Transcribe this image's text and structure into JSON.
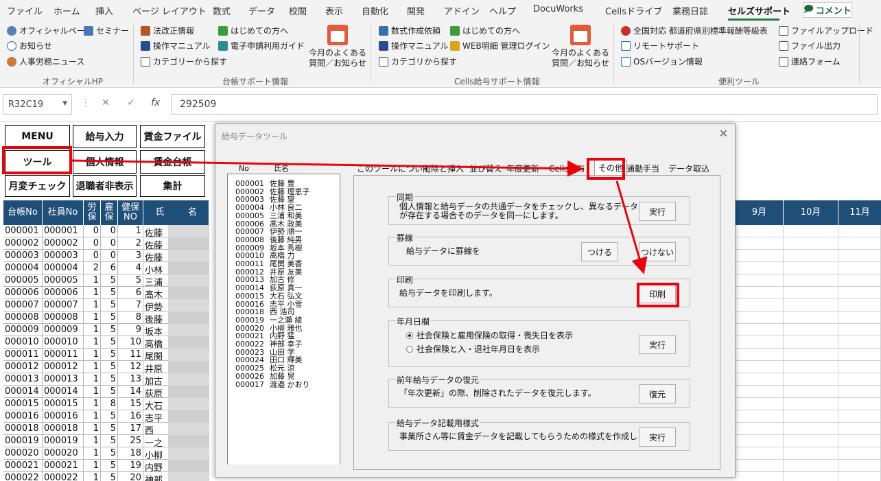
{
  "ribbon_tabs": [
    "ファイル",
    "ホーム",
    "挿入",
    "ページ レイアウト",
    "数式",
    "データ",
    "校閲",
    "表示",
    "自動化",
    "開発",
    "アドイン",
    "ヘルプ",
    "DocuWorks",
    "Cellsドライブ",
    "業務日誌",
    "セルズサポート"
  ],
  "comment_label": "コメント",
  "ribbon": {
    "g1": {
      "items": [
        "オフィシャルページ",
        "お知らせ",
        "人事労務ニュース",
        "セミナー"
      ],
      "label": "オフィシャルHP"
    },
    "g2": {
      "items": [
        "法改正情報",
        "操作マニュアル",
        "カテゴリーから探す",
        "はじめての方へ",
        "電子申請利用ガイド"
      ],
      "big": "今月のよくある\n質問／お知らせ",
      "label": "台帳サポート情報"
    },
    "g3": {
      "items": [
        "数式作成依頼",
        "操作マニュアル",
        "カテゴリから探す",
        "はじめての方へ",
        "WEB明細 管理ログイン"
      ],
      "big": "今月のよくある\n質問／お知らせ",
      "label": "Cells給与サポート情報"
    },
    "g4": {
      "items": [
        "全国対応 都道府県別標準報酬等級表",
        "リモートサポート",
        "OSバージョン情報",
        "ファイルアップロード",
        "ファイル出力",
        "連絡フォーム"
      ],
      "label": "便利ツール"
    }
  },
  "formula_bar": {
    "name_box": "R32C19",
    "cancel": "✕",
    "enter": "✓",
    "fx": "fx",
    "value": "292509"
  },
  "sheet_buttons": [
    "MENU",
    "給与入力",
    "賃金ファイル",
    "ツール",
    "個人情報",
    "賃金台帳",
    "月変チェック",
    "退職者非表示",
    "集計"
  ],
  "grid_headers": [
    "台帳No",
    "社員No",
    "労\n保",
    "雇\n保",
    "健保\nNO",
    "氏",
    "名"
  ],
  "month_headers": [
    "9月",
    "10月",
    "11月"
  ],
  "grid_rows": [
    [
      "000001",
      "000001",
      "0",
      "0",
      "1",
      "佐藤"
    ],
    [
      "000002",
      "000002",
      "0",
      "0",
      "2",
      "佐藤"
    ],
    [
      "000003",
      "000003",
      "0",
      "0",
      "3",
      "佐藤"
    ],
    [
      "000004",
      "000004",
      "2",
      "6",
      "4",
      "小林"
    ],
    [
      "000005",
      "000005",
      "1",
      "5",
      "5",
      "三浦"
    ],
    [
      "000006",
      "000006",
      "1",
      "5",
      "6",
      "髙木"
    ],
    [
      "000007",
      "000007",
      "1",
      "5",
      "7",
      "伊勢"
    ],
    [
      "000008",
      "000008",
      "1",
      "5",
      "8",
      "後藤"
    ],
    [
      "000009",
      "000009",
      "1",
      "5",
      "9",
      "坂本"
    ],
    [
      "000010",
      "000010",
      "1",
      "5",
      "10",
      "高橋"
    ],
    [
      "000011",
      "000011",
      "1",
      "5",
      "11",
      "尾関"
    ],
    [
      "000012",
      "000012",
      "1",
      "5",
      "12",
      "井原"
    ],
    [
      "000013",
      "000013",
      "1",
      "5",
      "13",
      "加古"
    ],
    [
      "000014",
      "000014",
      "1",
      "5",
      "14",
      "荻原"
    ],
    [
      "000015",
      "000015",
      "1",
      "8",
      "15",
      "大石"
    ],
    [
      "000016",
      "000016",
      "1",
      "5",
      "16",
      "志平"
    ],
    [
      "000018",
      "000018",
      "1",
      "5",
      "17",
      "西"
    ],
    [
      "000019",
      "000019",
      "1",
      "5",
      "25",
      "一之"
    ],
    [
      "000020",
      "000020",
      "1",
      "5",
      "18",
      "小柳"
    ],
    [
      "000021",
      "000021",
      "1",
      "5",
      "19",
      "内野"
    ],
    [
      "000022",
      "000022",
      "1",
      "5",
      "20",
      "神部"
    ]
  ],
  "dialog": {
    "title": "給与データツール",
    "list_header_no": "No",
    "list_header_name": "氏名",
    "list": [
      [
        "000001",
        "佐藤 豊"
      ],
      [
        "000002",
        "佐藤 理恵子"
      ],
      [
        "000003",
        "佐藤 望"
      ],
      [
        "000004",
        "小林 良二"
      ],
      [
        "000005",
        "三浦 和美"
      ],
      [
        "000006",
        "髙木 政美"
      ],
      [
        "000007",
        "伊勢 順一"
      ],
      [
        "000008",
        "後藤 純男"
      ],
      [
        "000009",
        "坂本 秀樹"
      ],
      [
        "000010",
        "高橋 力"
      ],
      [
        "000011",
        "尾関 美香"
      ],
      [
        "000012",
        "井原 友美"
      ],
      [
        "000013",
        "加古 修"
      ],
      [
        "000014",
        "荻原 真一"
      ],
      [
        "000015",
        "大石 弘文"
      ],
      [
        "000016",
        "志平 小雪"
      ],
      [
        "000018",
        "西 浩司"
      ],
      [
        "000019",
        "一之瀬 綾"
      ],
      [
        "000020",
        "小柳 雅也"
      ],
      [
        "000021",
        "内野 猛"
      ],
      [
        "000022",
        "神部 幸子"
      ],
      [
        "000023",
        "山田 学"
      ],
      [
        "000024",
        "田口 輝美"
      ],
      [
        "000025",
        "松元 涼"
      ],
      [
        "000026",
        "加藤 晃"
      ],
      [
        "000017",
        "渡邉 かおり"
      ]
    ],
    "tabs": [
      "このツールについて",
      "削除と挿入",
      "並び替え",
      "年度更新",
      "Cells給与",
      "その他",
      "通勤手当",
      "データ取込"
    ],
    "groups": [
      {
        "title": "同期",
        "desc": "個人情報と給与データの共通データをチェックし、異なるデータ\nが存在する場合そのデータを同一にします。",
        "buttons": [
          "実行"
        ]
      },
      {
        "title": "罫線",
        "desc": "給与データに罫線を",
        "buttons": [
          "つける",
          "つけない"
        ]
      },
      {
        "title": "印刷",
        "desc": "給与データを印刷します。",
        "buttons": [
          "印刷"
        ]
      },
      {
        "title": "年月日欄",
        "options": [
          "社会保険と雇用保険の取得・喪失日を表示",
          "社会保険と入・退社年月日を表示"
        ],
        "buttons": [
          "実行"
        ]
      },
      {
        "title": "前年給与データの復元",
        "desc": "「年次更新」の際、削除されたデータを復元します。",
        "buttons": [
          "復元"
        ]
      },
      {
        "title": "給与データ記載用様式",
        "desc": "事業所さん等に賃金データを記載してもらうための様式を作成します。",
        "buttons": [
          "実行"
        ]
      }
    ]
  },
  "colors": {
    "excel_green": "#217346",
    "header_blue": "#1f4e79",
    "highlight_red": "#e4050f"
  }
}
